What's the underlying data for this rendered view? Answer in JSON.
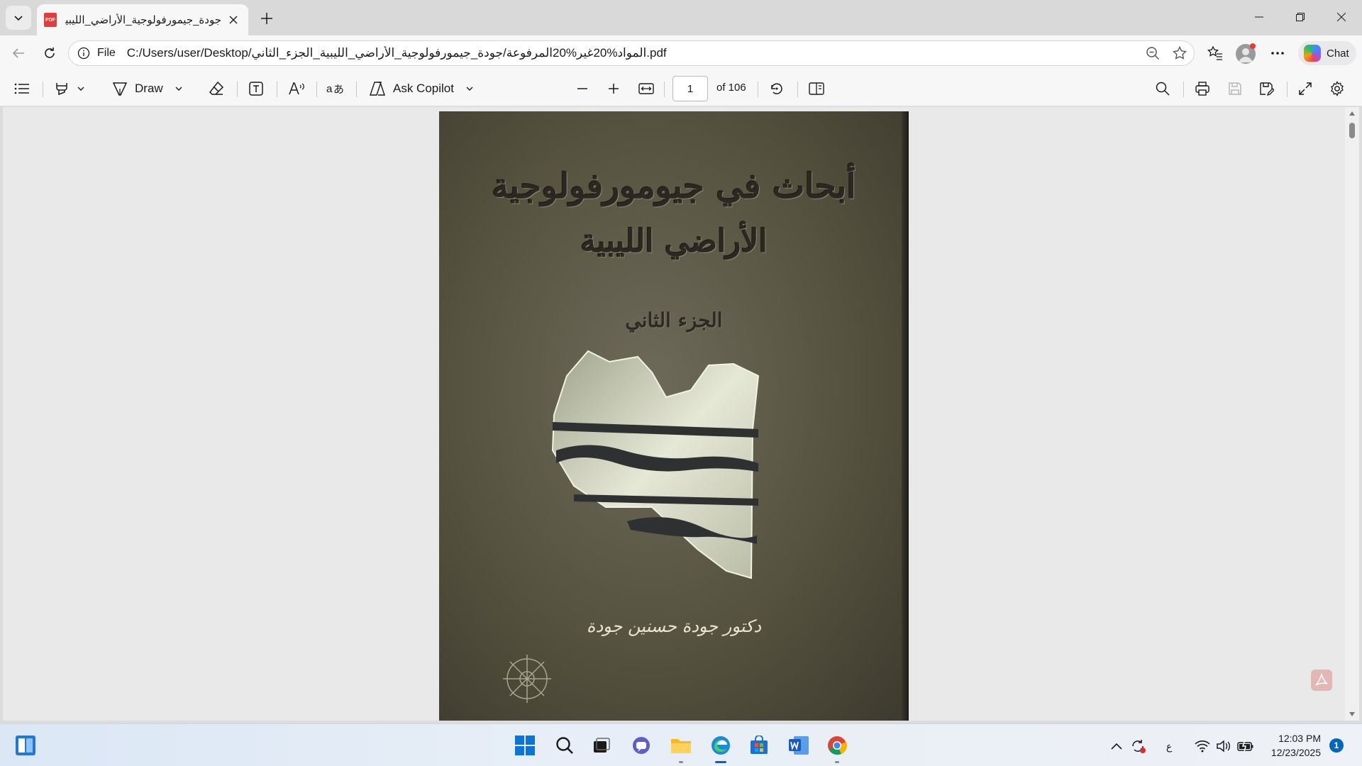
{
  "browser": {
    "tab": {
      "title": "جودة_جيمورفولوجية_الأراضي_الليبية_الجزء_الثاني",
      "favicon": "PDF"
    },
    "window_controls": [
      "minimize",
      "restore",
      "close"
    ],
    "address": {
      "scheme_label": "File",
      "url": "C:/Users/user/Desktop/المواد%20غير%20المرفوعة/جودة_جيمورفولوجية_الأراضي_الليبية_الجزء_الثاني.pdf"
    },
    "chat_label": "Chat"
  },
  "pdf_toolbar": {
    "draw_label": "Draw",
    "ask_copilot_label": "Ask Copilot",
    "page_current": "1",
    "page_total": "of 106"
  },
  "document": {
    "cover_title": "أبحاث في جيومورفولوجية",
    "cover_subtitle": "الأراضي الليبية",
    "cover_part": "الجزء الثاني",
    "cover_author": "دكتور جودة حسنين جودة"
  },
  "taskbar": {
    "apps": [
      "windows-start",
      "search",
      "task-view",
      "teams",
      "file-explorer",
      "edge",
      "microsoft-store",
      "word",
      "chrome"
    ],
    "lang": "ع",
    "time": "12:03 PM",
    "date": "12/23/2025",
    "notifications": "1"
  },
  "colors": {
    "accent": "#0067c0",
    "pdf_red": "#e13d3d",
    "cover_green": "#55523f"
  }
}
